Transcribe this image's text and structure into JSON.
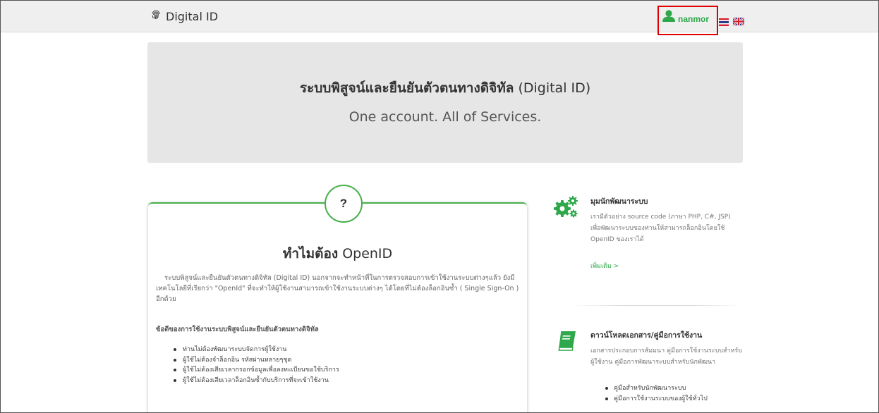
{
  "navbar": {
    "brand": "Digital ID",
    "user_name": "nanmor",
    "fingerprint_icon": "fingerprint-icon",
    "user_icon": "user-icon",
    "menu_icon": "hamburger-icon",
    "flag_icon": "uk-flag-icon"
  },
  "hero": {
    "title_bold": "ระบบพิสูจน์และยืนยันตัวตนทางดิจิทัล",
    "title_light": "(Digital ID)",
    "subtitle": "One account. All of Services."
  },
  "why": {
    "icon_text": "?",
    "title_bold": "ทำไมต้อง",
    "title_light": "OpenID",
    "description": "ระบบพิสูจน์และยืนยันตัวตนทางดิจิทัล (Digital ID) นอกจากจะทำหน้าที่ในการตรวจสอบการเข้าใช้งานระบบต่างๆแล้ว ยังมีเทคโนโลยีที่เรียกว่า \"OpenId\" ที่จะทำให้ผู้ใช้งานสามารถเข้าใช้งานระบบต่างๆ ได้โดยที่ไม่ต้องล็อกอินซ้ำ ( Single Sign-On ) อีกด้วย",
    "benefits_title": "ข้อดีของการใช้งานระบบพิสูจน์และยืนยันตัวตนทางดิจิทัล",
    "benefits": [
      "ท่านไม่ต้องพัฒนาระบบจัดการผู้ใช้งาน",
      "ผู้ใช้ไม่ต้องจำล็อกอิน รหัสผ่านหลายๆชุด",
      "ผู้ใช้ไม่ต้องเสียเวลากรอกข้อมูลเพื่อลงทะเบียนขอใช้บริการ",
      "ผู้ใช้ไม่ต้องเสียเวลาล็อกอินซ้ำกับบริการที่จะเข้าใช้งาน"
    ]
  },
  "developer": {
    "icon": "gears-icon",
    "title": "มุมนักพัฒนาระบบ",
    "description": "เรามีตัวอย่าง source code (ภาษา PHP, C#, JSP) เพื่อพัฒนาระบบของท่านให้สามารถล็อกอินโดยใช้ OpenID ของเราได้",
    "more_link": "เพิ่มเติม >"
  },
  "downloads": {
    "icon": "book-icon",
    "title": "ดาวน์โหลดเอกสาร/คู่มือการใช้งาน",
    "description": "เอกสารประกอบการสัมมนา คู่มือการใช้งานระบบสำหรับผู้ใช้งาน คู่มือการพัฒนาระบบสำหรับนักพัฒนา",
    "items": [
      "คู่มือสำหรับนักพัฒนาระบบ",
      "คู่มือการใช้งานระบบของผู้ใช้ทั่วไป"
    ]
  },
  "colors": {
    "accent": "#46b04a",
    "highlight_box": "#e00000",
    "hero_bg": "#e6e6e6"
  }
}
